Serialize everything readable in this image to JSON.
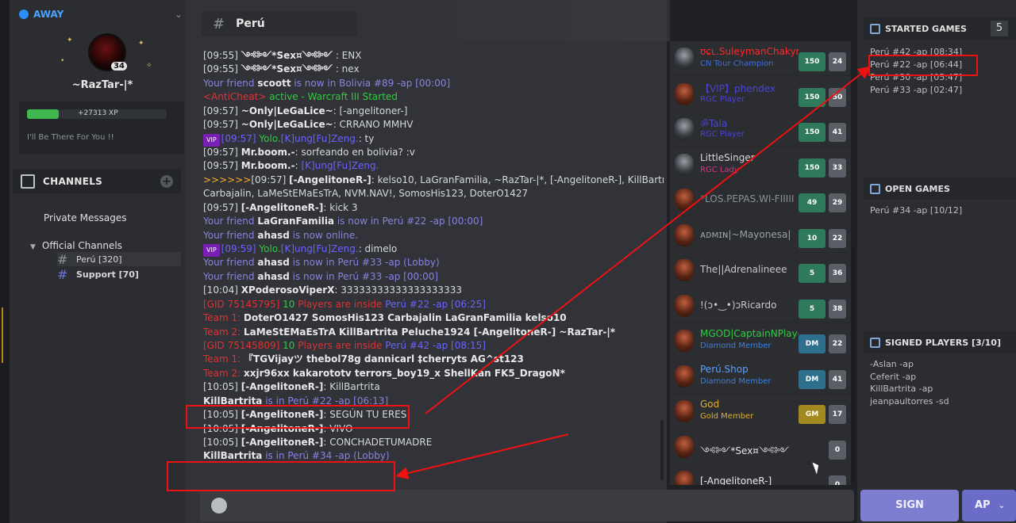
{
  "sidebar": {
    "status": "AWAY",
    "avatar_level": "34",
    "username": "~RazTar-|*",
    "xp": "+27313 XP",
    "motto": "I'll Be There For You !!",
    "channels_label": "CHANNELS",
    "private_messages": "Private Messages",
    "official_channels": "Official Channels",
    "channels": [
      {
        "name": "Perú [320]",
        "active": true
      },
      {
        "name": "Support [70]",
        "active": false
      }
    ]
  },
  "chat": {
    "channel_title": "Perú",
    "messages": [
      [
        {
          "t": "[09:55] ",
          "c": "c-w"
        },
        {
          "t": "༺༻*Sex¤༺༻",
          "c": "c-b"
        },
        {
          "t": " : ENX",
          "c": "c-w"
        }
      ],
      [
        {
          "t": "[09:55] ",
          "c": "c-w"
        },
        {
          "t": "༺༻*Sex¤༺༻",
          "c": "c-b"
        },
        {
          "t": " : nex",
          "c": "c-w"
        }
      ],
      [
        {
          "t": "Your friend ",
          "c": "c-p"
        },
        {
          "t": "scoott",
          "c": "c-b"
        },
        {
          "t": " is now in Bolivia #89 -ap [00:00]",
          "c": "c-p"
        }
      ],
      [
        {
          "t": "<AntiCheat> ",
          "c": "c-red"
        },
        {
          "t": "active - Warcraft III Started",
          "c": "c-g"
        }
      ],
      [
        {
          "t": "[09:57] ",
          "c": "c-w"
        },
        {
          "t": "~Only|LeGaLice~",
          "c": "c-b"
        },
        {
          "t": ": [-angelitoner-]",
          "c": "c-w"
        }
      ],
      [
        {
          "t": "[09:57] ",
          "c": "c-w"
        },
        {
          "t": "~Only|LeGaLice~",
          "c": "c-b"
        },
        {
          "t": ": CRRANO MMHV",
          "c": "c-w"
        }
      ],
      [
        {
          "t": "VIP",
          "c": "vip"
        },
        {
          "t": "[09:57] ",
          "c": "c-bl"
        },
        {
          "t": "Yolo.",
          "c": "c-g"
        },
        {
          "t": "[K]ung[Fu]Zeng.",
          "c": "c-bl"
        },
        {
          "t": ": ty",
          "c": "c-w"
        }
      ],
      [
        {
          "t": "[09:57] ",
          "c": "c-w"
        },
        {
          "t": "Mr.boom.-",
          "c": "c-b"
        },
        {
          "t": ": sorfeando en bolivia? :v",
          "c": "c-w"
        }
      ],
      [
        {
          "t": "[09:57] ",
          "c": "c-w"
        },
        {
          "t": "Mr.boom.-",
          "c": "c-b"
        },
        {
          "t": ": ",
          "c": "c-w"
        },
        {
          "t": "[K]ung[Fu]Zeng.",
          "c": "c-bl"
        }
      ],
      [
        {
          "t": ">>>>>>",
          "c": "c-o"
        },
        {
          "t": "[09:57] ",
          "c": "c-w"
        },
        {
          "t": "[-AngelitoneR-]",
          "c": "c-b"
        },
        {
          "t": ": kelso10, LaGranFamilia, ~RazTar-|*, [-AngelitoneR-], KillBartrita,",
          "c": "c-w"
        }
      ],
      [
        {
          "t": "Carbajalin, LaMeStEMaEsTrA, NVM.NAV!, SomosHis123, DoterO1427",
          "c": "c-w"
        }
      ],
      [
        {
          "t": "[09:57] ",
          "c": "c-w"
        },
        {
          "t": "[-AngelitoneR-]",
          "c": "c-b"
        },
        {
          "t": ": kick 3",
          "c": "c-w"
        }
      ],
      [
        {
          "t": "Your friend ",
          "c": "c-p"
        },
        {
          "t": "LaGranFamilia",
          "c": "c-b"
        },
        {
          "t": " is now in Perú  #22 -ap [00:00]",
          "c": "c-p"
        }
      ],
      [
        {
          "t": "Your friend ",
          "c": "c-p"
        },
        {
          "t": "ahasd",
          "c": "c-b"
        },
        {
          "t": " is now online.",
          "c": "c-p"
        }
      ],
      [
        {
          "t": "VIP",
          "c": "vip"
        },
        {
          "t": "[09:59] ",
          "c": "c-bl"
        },
        {
          "t": "Yolo.",
          "c": "c-g"
        },
        {
          "t": "[K]ung[Fu]Zeng.",
          "c": "c-bl"
        },
        {
          "t": ": dimelo",
          "c": "c-w"
        }
      ],
      [
        {
          "t": "Your friend ",
          "c": "c-p"
        },
        {
          "t": "ahasd",
          "c": "c-b"
        },
        {
          "t": " is now in Perú  #33 -ap (Lobby)",
          "c": "c-p"
        }
      ],
      [
        {
          "t": "Your friend ",
          "c": "c-p"
        },
        {
          "t": "ahasd",
          "c": "c-b"
        },
        {
          "t": " is now in Perú  #33 -ap [00:00]",
          "c": "c-p"
        }
      ],
      [
        {
          "t": "[10:04] ",
          "c": "c-w"
        },
        {
          "t": "XPoderosoViperX",
          "c": "c-b"
        },
        {
          "t": ": 33333333333333333333",
          "c": "c-w"
        }
      ],
      [
        {
          "t": "[GID 75145795] ",
          "c": "c-red"
        },
        {
          "t": "10 ",
          "c": "c-g"
        },
        {
          "t": "Players are inside ",
          "c": "c-red"
        },
        {
          "t": "Perú  #22 -ap [06:25]",
          "c": "c-bl"
        }
      ],
      [
        {
          "t": "Team 1:   ",
          "c": "c-red"
        },
        {
          "t": "DoterO1427   SomosHis123   Carbajalin   LaGranFamilia   kelso10",
          "c": "c-b"
        }
      ],
      [
        {
          "t": "Team 2:   ",
          "c": "c-red"
        },
        {
          "t": "LaMeStEMaEsTrA   KillBartrita   Peluche1924   [-AngelitoneR-]   ~RazTar-|*",
          "c": "c-b"
        }
      ],
      [
        {
          "t": "[GID 75145809] ",
          "c": "c-red"
        },
        {
          "t": "10 ",
          "c": "c-g"
        },
        {
          "t": "Players are inside ",
          "c": "c-red"
        },
        {
          "t": "Perú  #42 -ap [08:15]",
          "c": "c-bl"
        }
      ],
      [
        {
          "t": "Team 1:   ",
          "c": "c-red"
        },
        {
          "t": "『TGVijayツ   thebol78g   dannicarl   ‡cherryts   AG^st123",
          "c": "c-b"
        }
      ],
      [
        {
          "t": "Team 2:   ",
          "c": "c-red"
        },
        {
          "t": "xxjr96xx   kakarototv   terrors_boy19_x   ShellKan   FK5_DragoN*",
          "c": "c-b"
        }
      ],
      [
        {
          "t": "[10:05] ",
          "c": "c-w"
        },
        {
          "t": "[-AngelitoneR-]",
          "c": "c-b"
        },
        {
          "t": ": KillBartrita",
          "c": "c-w"
        }
      ],
      [
        {
          "t": "KillBartrita",
          "c": "c-b"
        },
        {
          "t": " is in Perú  #22 -ap [06:13]",
          "c": "c-p"
        }
      ],
      [
        {
          "t": "[10:05] ",
          "c": "c-w"
        },
        {
          "t": "[-AngelitoneR-]",
          "c": "c-b"
        },
        {
          "t": ": SEGÚN TU ERES",
          "c": "c-w"
        }
      ],
      [
        {
          "t": "[10:05] ",
          "c": "c-w"
        },
        {
          "t": "[-AngelitoneR-]",
          "c": "c-b"
        },
        {
          "t": ": VIVO",
          "c": "c-w"
        }
      ],
      [
        {
          "t": "[10:05] ",
          "c": "c-w"
        },
        {
          "t": "[-AngelitoneR-]",
          "c": "c-b"
        },
        {
          "t": ": CONCHADETUMADRE",
          "c": "c-w"
        }
      ],
      [
        {
          "t": "KillBartrita",
          "c": "c-b"
        },
        {
          "t": " is in Perú  #34 -ap (Lobby)",
          "c": "c-p"
        }
      ]
    ]
  },
  "users": [
    {
      "name": "ʊɕʟ.SuleymanChakyr",
      "name_color": "#ff2a2a",
      "role": "CN Tour Champion",
      "role_color": "#3a6fe0",
      "level": "150",
      "count": "24",
      "avatar": "black",
      "badge": "level"
    },
    {
      "name": "【VIP】phendex",
      "name_color": "#4a43d8",
      "role": "RGC Player",
      "role_color": "#4a43d8",
      "level": "150",
      "count": "50",
      "avatar": "red",
      "badge": "level"
    },
    {
      "name": "ॐTala",
      "name_color": "#4a43d8",
      "role": "RGC Player",
      "role_color": "#4a43d8",
      "level": "150",
      "count": "41",
      "avatar": "black",
      "badge": "level"
    },
    {
      "name": "LittleSinger",
      "name_color": "#d8d8d8",
      "role": "RGC Lady",
      "role_color": "#e0308a",
      "level": "150",
      "count": "33",
      "avatar": "black",
      "badge": "level"
    },
    {
      "name": "*LOS.PEPAS.WI-FIIIII",
      "name_color": "#8a8f96",
      "role": "",
      "role_color": "#8a8f96",
      "level": "49",
      "count": "29",
      "avatar": "red",
      "badge": "level"
    },
    {
      "name": "ᴀᴅᴍɪɴ|~Mayonesa|",
      "name_color": "#9aa0a6",
      "role": "",
      "role_color": "#8a8f96",
      "level": "10",
      "count": "22",
      "avatar": "red",
      "badge": "level"
    },
    {
      "name": "The||Adrenalineee",
      "name_color": "#c8c8c8",
      "role": "",
      "role_color": "#8a8f96",
      "level": "5",
      "count": "36",
      "avatar": "red",
      "badge": "level"
    },
    {
      "name": "!(ɔ•‿•)ɔRicardo",
      "name_color": "#c8c8c8",
      "role": "",
      "role_color": "#8a8f96",
      "level": "5",
      "count": "38",
      "avatar": "red",
      "badge": "level"
    },
    {
      "name": "MGOD|CaptainNPlayer",
      "name_color": "#2ecc40",
      "role": "Diamond Member",
      "role_color": "#3a7fe0",
      "level": "DM",
      "count": "22",
      "avatar": "red",
      "badge": "dm"
    },
    {
      "name": "Perú.Shop",
      "name_color": "#5a9fff",
      "role": "Diamond Member",
      "role_color": "#3a7fe0",
      "level": "DM",
      "count": "41",
      "avatar": "red",
      "badge": "dm"
    },
    {
      "name": "God",
      "name_color": "#e0b030",
      "role": "Gold Member",
      "role_color": "#e0b030",
      "level": "GM",
      "count": "17",
      "avatar": "red",
      "badge": "gm"
    },
    {
      "name": "༺༻*Sex¤༺༻",
      "name_color": "#e8e8e8",
      "role": "",
      "role_color": "#8a8f96",
      "level": "",
      "count": "0",
      "avatar": "red",
      "badge": "none"
    },
    {
      "name": "[-AngelitoneR-]",
      "name_color": "#e8e8e8",
      "role": "",
      "role_color": "#8a8f96",
      "level": "",
      "count": "0",
      "avatar": "red",
      "badge": "none"
    }
  ],
  "right_panel": {
    "started_title": "STARTED GAMES",
    "started_count": "5",
    "started_games": [
      "Perú  #42 -ap [08:34]",
      "Perú  #22 -ap [06:44]",
      "Perú  #30 -ap [05:47]",
      "Perú  #33 -ap [02:47]"
    ],
    "open_title": "OPEN GAMES",
    "open_games": [
      "Perú  #34 -ap [10/12]"
    ],
    "signed_title": "SIGNED PLAYERS [3/10]",
    "signed_players": [
      "-Aslan -ap",
      "Ceferit -ap",
      "KillBartrita -ap",
      "jeanpaultorres -sd"
    ],
    "sign_label": "SIGN",
    "ap_label": "AP"
  },
  "colors": {
    "accent": "#7e7ed0",
    "annotation": "#e11111",
    "status": "#2d8cff"
  }
}
